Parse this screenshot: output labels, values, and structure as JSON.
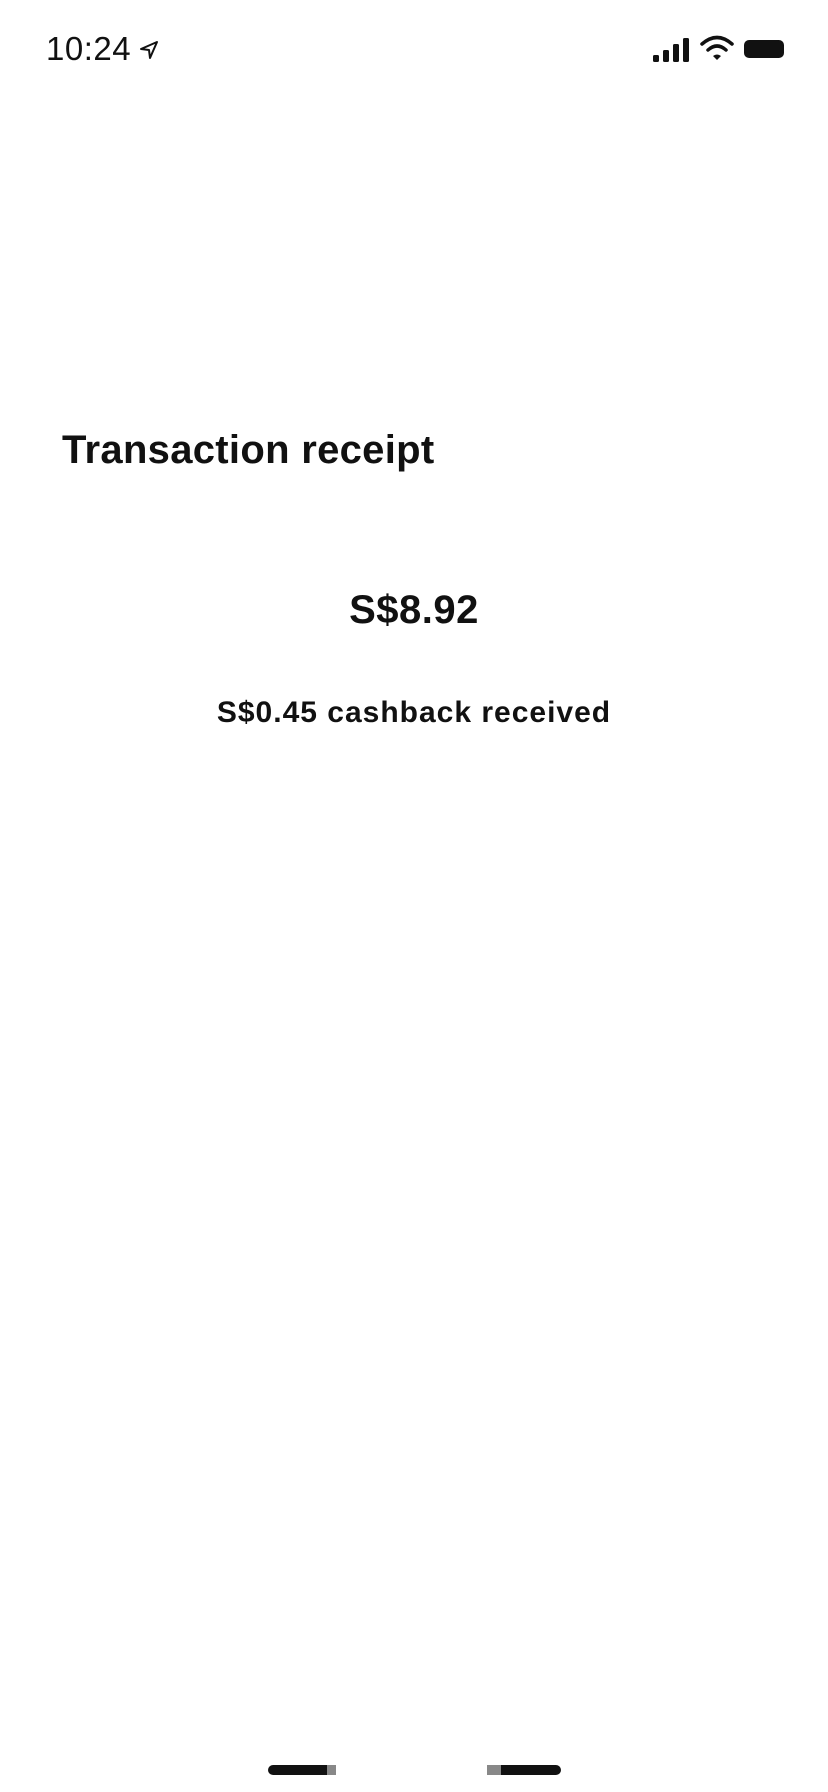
{
  "status_bar": {
    "time": "10:24",
    "icons": [
      "location-icon",
      "signal-icon",
      "wifi-icon",
      "battery-icon"
    ]
  },
  "receipt": {
    "title": "Transaction receipt",
    "amount": "S$8.92",
    "cashback": "S$0.45 cashback received"
  },
  "colors": {
    "background": "#ffffff",
    "text": "#111111",
    "indicator_accent": "#888888"
  }
}
